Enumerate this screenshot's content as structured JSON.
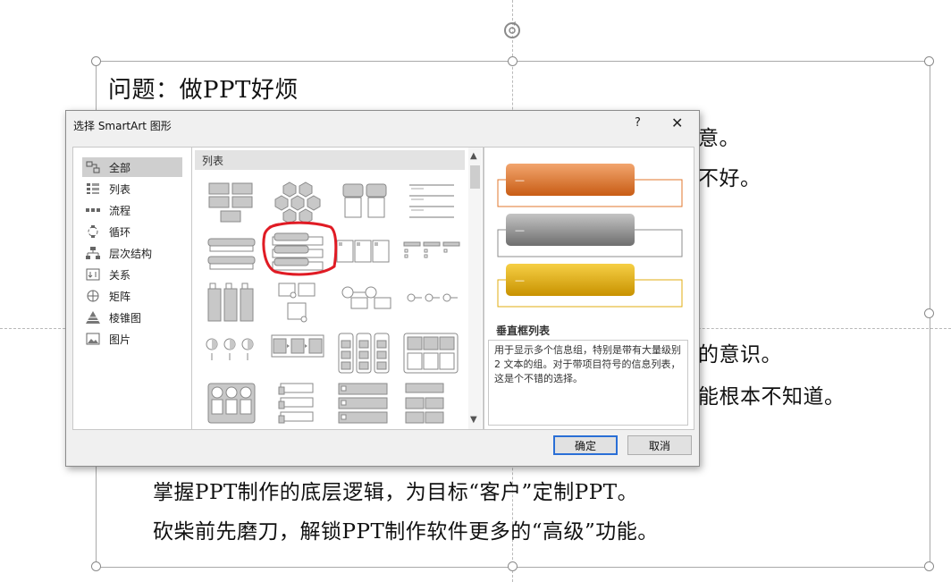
{
  "slide": {
    "title": "问题：做PPT好烦",
    "line_right_1": "意。",
    "line_right_2": "不好。",
    "line_right_3": "的意识。",
    "line_right_4": "能根本不知道。",
    "bullet_1": "掌握PPT制作的底层逻辑，为目标“客户”定制PPT。",
    "bullet_2": "砍柴前先磨刀，解锁PPT制作软件更多的“高级”功能。"
  },
  "dialog": {
    "title": "选择 SmartArt 图形",
    "help_label": "?",
    "close_label": "✕",
    "categories": [
      {
        "label": "全部",
        "icon": "all-icon",
        "selected": true
      },
      {
        "label": "列表",
        "icon": "list-icon",
        "selected": false
      },
      {
        "label": "流程",
        "icon": "process-icon",
        "selected": false
      },
      {
        "label": "循环",
        "icon": "cycle-icon",
        "selected": false
      },
      {
        "label": "层次结构",
        "icon": "hierarchy-icon",
        "selected": false
      },
      {
        "label": "关系",
        "icon": "relationship-icon",
        "selected": false
      },
      {
        "label": "矩阵",
        "icon": "matrix-icon",
        "selected": false
      },
      {
        "label": "棱锥图",
        "icon": "pyramid-icon",
        "selected": false
      },
      {
        "label": "图片",
        "icon": "picture-icon",
        "selected": false
      }
    ],
    "gallery_header": "列表",
    "selected_layout_index": 5,
    "preview": {
      "name": "垂直框列表",
      "description": "用于显示多个信息组，特别是带有大量级别 2 文本的组。对于带项目符号的信息列表，这是个不错的选择。",
      "bar_colors": [
        "#e0772c",
        "#8e8e8e",
        "#e0ae10"
      ],
      "bar_text": "—"
    },
    "ok_label": "确定",
    "cancel_label": "取消",
    "accent_color": "#2a6fd6",
    "highlight_color": "#e01b24"
  }
}
